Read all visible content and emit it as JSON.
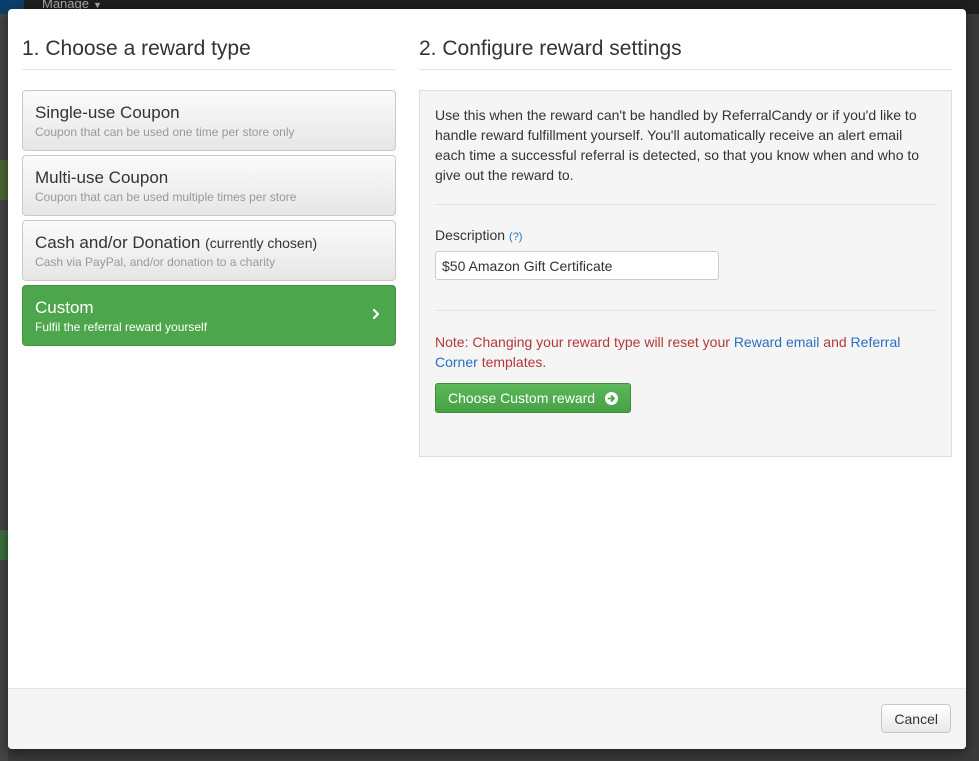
{
  "background": {
    "menu_label": "Manage",
    "accent": "#0b3f6e"
  },
  "left": {
    "title": "1. Choose a reward type",
    "items": [
      {
        "name": "Single-use Coupon",
        "chosen_note": "",
        "description": "Coupon that can be used one time per store only",
        "active": false
      },
      {
        "name": "Multi-use Coupon",
        "chosen_note": "",
        "description": "Coupon that can be used multiple times per store",
        "active": false
      },
      {
        "name": "Cash and/or Donation",
        "chosen_note": "(currently chosen)",
        "description": "Cash via PayPal, and/or donation to a charity",
        "active": false
      },
      {
        "name": "Custom",
        "chosen_note": "",
        "description": "Fulfil the referral reward yourself",
        "active": true
      }
    ]
  },
  "right": {
    "title": "2. Configure reward settings",
    "intro": "Use this when the reward can't be handled by ReferralCandy or if you'd like to handle reward fulfillment yourself. You'll automatically receive an alert email each time a successful referral is detected, so that you know when and who to give out the reward to.",
    "description_label": "Description",
    "help_link": "(?)",
    "description_value": "$50 Amazon Gift Certificate",
    "note_prefix": "Note: Changing your reward type will reset your",
    "note_link1": "Reward email",
    "note_and": "and",
    "note_link2": "Referral Corner",
    "note_suffix": "templates.",
    "choose_button": "Choose Custom reward"
  },
  "footer": {
    "cancel": "Cancel"
  },
  "colors": {
    "active_green": "#4da64b",
    "note_red": "#b33838",
    "link_blue": "#2a6fbf"
  }
}
